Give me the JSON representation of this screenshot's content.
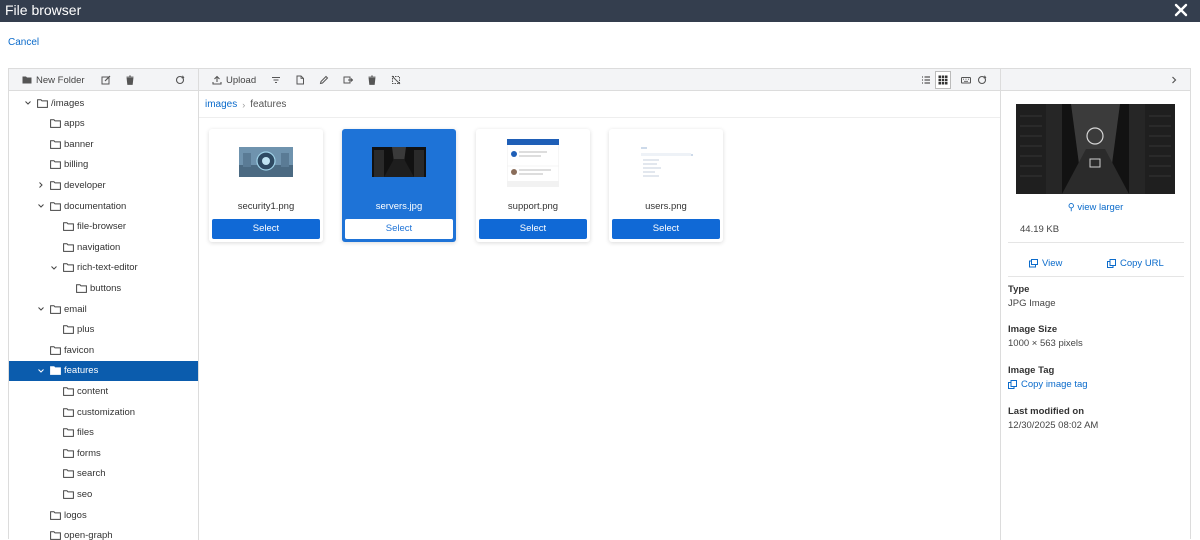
{
  "window": {
    "title": "File browser",
    "close_icon": "close-icon"
  },
  "cancel_label": "Cancel",
  "left_toolbar": {
    "new_folder_label": "New Folder"
  },
  "main_toolbar": {
    "upload_label": "Upload"
  },
  "tree": [
    {
      "label": "/images",
      "chevron": "down"
    },
    {
      "label": "apps"
    },
    {
      "label": "banner"
    },
    {
      "label": "billing"
    },
    {
      "label": "developer",
      "chevron": "right"
    },
    {
      "label": "documentation",
      "chevron": "down"
    },
    {
      "label": "file-browser"
    },
    {
      "label": "navigation"
    },
    {
      "label": "rich-text-editor",
      "chevron": "down"
    },
    {
      "label": "buttons"
    },
    {
      "label": "email",
      "chevron": "down"
    },
    {
      "label": "plus"
    },
    {
      "label": "favicon"
    },
    {
      "label": "features",
      "chevron": "down",
      "selected": true
    },
    {
      "label": "content"
    },
    {
      "label": "customization"
    },
    {
      "label": "files"
    },
    {
      "label": "forms"
    },
    {
      "label": "search"
    },
    {
      "label": "seo"
    },
    {
      "label": "logos"
    },
    {
      "label": "open-graph"
    }
  ],
  "breadcrumb": {
    "root": "images",
    "current": "features"
  },
  "files": [
    {
      "name": "security1.png",
      "select_label": "Select",
      "selected": false
    },
    {
      "name": "servers.jpg",
      "select_label": "Select",
      "selected": true
    },
    {
      "name": "support.png",
      "select_label": "Select",
      "selected": false
    },
    {
      "name": "users.png",
      "select_label": "Select",
      "selected": false
    }
  ],
  "details": {
    "view_larger_label": "view larger",
    "size": "44.19 KB",
    "view_label": "View",
    "copy_url_label": "Copy URL",
    "type_label": "Type",
    "type_value": "JPG Image",
    "image_size_label": "Image Size",
    "image_size_value": "1000 × 563 pixels",
    "image_tag_label": "Image Tag",
    "copy_tag_label": "Copy image tag",
    "modified_label": "Last modified on",
    "modified_value": "12/30/2025 08:02 AM"
  },
  "colors": {
    "titlebar": "#343e4e",
    "accent": "#1069d6",
    "selected_tree": "#0b5cad",
    "link": "#0b6bcb"
  }
}
